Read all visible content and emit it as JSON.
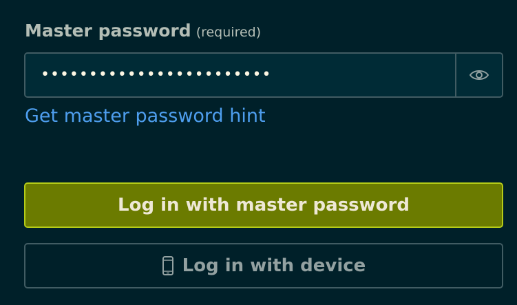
{
  "master_password": {
    "label": "Master password",
    "required_note": "(required)",
    "value": "••••••••••••••••••••••••",
    "visibility_icon": "eye-icon"
  },
  "hint_link": "Get master password hint",
  "buttons": {
    "login_master": "Log in with master password",
    "login_device": "Log in with device",
    "device_icon": "mobile-phone-icon"
  },
  "colors": {
    "background": "#002029",
    "input_background": "#002b36",
    "border": "#415c63",
    "link": "#4e9eee",
    "primary_button": "#6b7b00",
    "primary_button_border": "#b5cc18"
  }
}
